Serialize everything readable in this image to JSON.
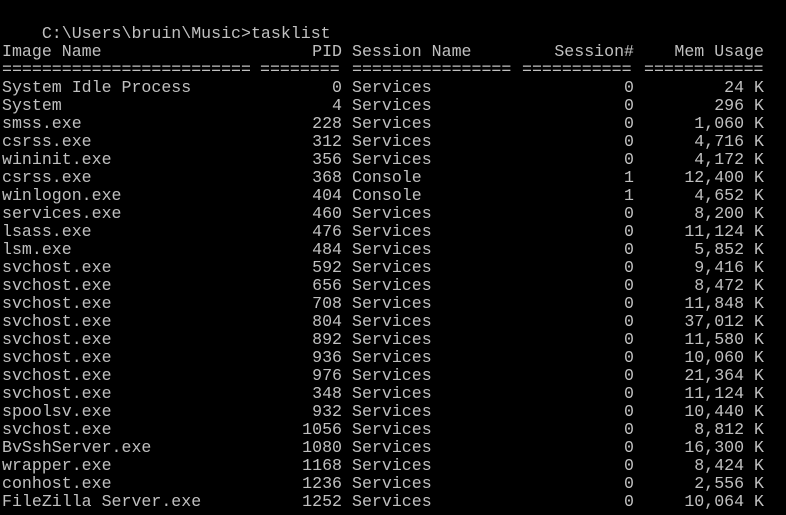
{
  "window": {
    "background": "#000000",
    "text_color": "#c0c0c0"
  },
  "console": {
    "prompt_line": "C:\\Users\\bruin\\Music>tasklist",
    "headers": {
      "image_name": "Image Name",
      "pid": "PID",
      "session_name": "Session Name",
      "session_num": "Session#",
      "mem_usage": "Mem Usage"
    },
    "separators": {
      "image_name": "=========================",
      "pid": "========",
      "session_name": "================",
      "session_num": "===========",
      "mem_usage": "============"
    },
    "rows": [
      {
        "name": "System Idle Process",
        "pid": "0",
        "session": "Services",
        "num": "0",
        "mem": "24 K"
      },
      {
        "name": "System",
        "pid": "4",
        "session": "Services",
        "num": "0",
        "mem": "296 K"
      },
      {
        "name": "smss.exe",
        "pid": "228",
        "session": "Services",
        "num": "0",
        "mem": "1,060 K"
      },
      {
        "name": "csrss.exe",
        "pid": "312",
        "session": "Services",
        "num": "0",
        "mem": "4,716 K"
      },
      {
        "name": "wininit.exe",
        "pid": "356",
        "session": "Services",
        "num": "0",
        "mem": "4,172 K"
      },
      {
        "name": "csrss.exe",
        "pid": "368",
        "session": "Console",
        "num": "1",
        "mem": "12,400 K"
      },
      {
        "name": "winlogon.exe",
        "pid": "404",
        "session": "Console",
        "num": "1",
        "mem": "4,652 K"
      },
      {
        "name": "services.exe",
        "pid": "460",
        "session": "Services",
        "num": "0",
        "mem": "8,200 K"
      },
      {
        "name": "lsass.exe",
        "pid": "476",
        "session": "Services",
        "num": "0",
        "mem": "11,124 K"
      },
      {
        "name": "lsm.exe",
        "pid": "484",
        "session": "Services",
        "num": "0",
        "mem": "5,852 K"
      },
      {
        "name": "svchost.exe",
        "pid": "592",
        "session": "Services",
        "num": "0",
        "mem": "9,416 K"
      },
      {
        "name": "svchost.exe",
        "pid": "656",
        "session": "Services",
        "num": "0",
        "mem": "8,472 K"
      },
      {
        "name": "svchost.exe",
        "pid": "708",
        "session": "Services",
        "num": "0",
        "mem": "11,848 K"
      },
      {
        "name": "svchost.exe",
        "pid": "804",
        "session": "Services",
        "num": "0",
        "mem": "37,012 K"
      },
      {
        "name": "svchost.exe",
        "pid": "892",
        "session": "Services",
        "num": "0",
        "mem": "11,580 K"
      },
      {
        "name": "svchost.exe",
        "pid": "936",
        "session": "Services",
        "num": "0",
        "mem": "10,060 K"
      },
      {
        "name": "svchost.exe",
        "pid": "976",
        "session": "Services",
        "num": "0",
        "mem": "21,364 K"
      },
      {
        "name": "svchost.exe",
        "pid": "348",
        "session": "Services",
        "num": "0",
        "mem": "11,124 K"
      },
      {
        "name": "spoolsv.exe",
        "pid": "932",
        "session": "Services",
        "num": "0",
        "mem": "10,440 K"
      },
      {
        "name": "svchost.exe",
        "pid": "1056",
        "session": "Services",
        "num": "0",
        "mem": "8,812 K"
      },
      {
        "name": "BvSshServer.exe",
        "pid": "1080",
        "session": "Services",
        "num": "0",
        "mem": "16,300 K"
      },
      {
        "name": "wrapper.exe",
        "pid": "1168",
        "session": "Services",
        "num": "0",
        "mem": "8,424 K"
      },
      {
        "name": "conhost.exe",
        "pid": "1236",
        "session": "Services",
        "num": "0",
        "mem": "2,556 K"
      },
      {
        "name": "FileZilla Server.exe",
        "pid": "1252",
        "session": "Services",
        "num": "0",
        "mem": "10,064 K"
      }
    ]
  }
}
